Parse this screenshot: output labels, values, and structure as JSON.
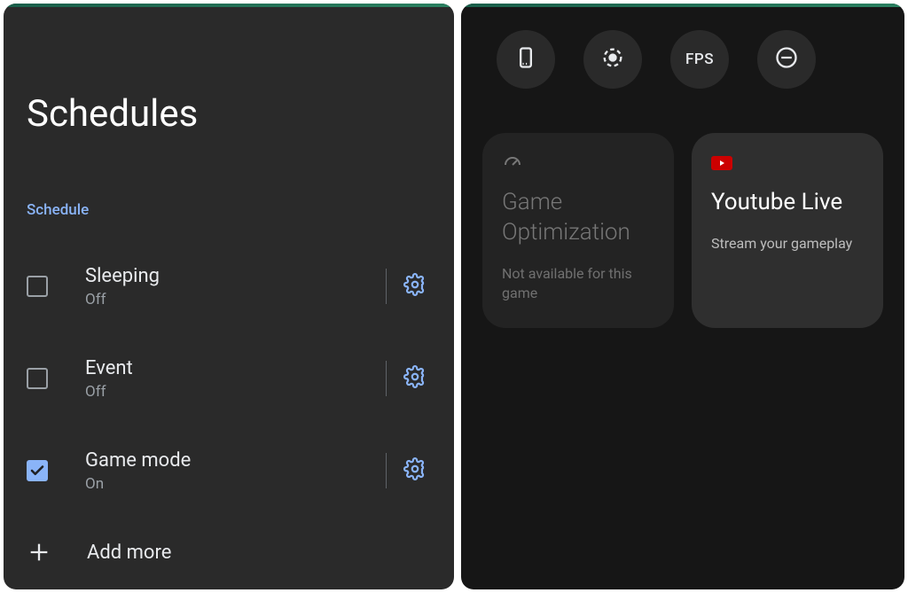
{
  "left": {
    "title": "Schedules",
    "section_label": "Schedule",
    "items": [
      {
        "name": "Sleeping",
        "status": "Off",
        "checked": false
      },
      {
        "name": "Event",
        "status": "Off",
        "checked": false
      },
      {
        "name": "Game mode",
        "status": "On",
        "checked": true
      }
    ],
    "add_label": "Add more"
  },
  "right": {
    "quick": [
      {
        "icon": "screenshot-icon"
      },
      {
        "icon": "record-icon"
      },
      {
        "icon": "fps-icon",
        "text": "FPS"
      },
      {
        "icon": "dnd-icon"
      }
    ],
    "cards": [
      {
        "icon": "speedometer-icon",
        "title": "Game Optimization",
        "subtitle": "Not available for this game",
        "state": "disabled"
      },
      {
        "icon": "youtube-icon",
        "title": "Youtube Live",
        "subtitle": "Stream your gameplay",
        "state": "active"
      }
    ]
  }
}
